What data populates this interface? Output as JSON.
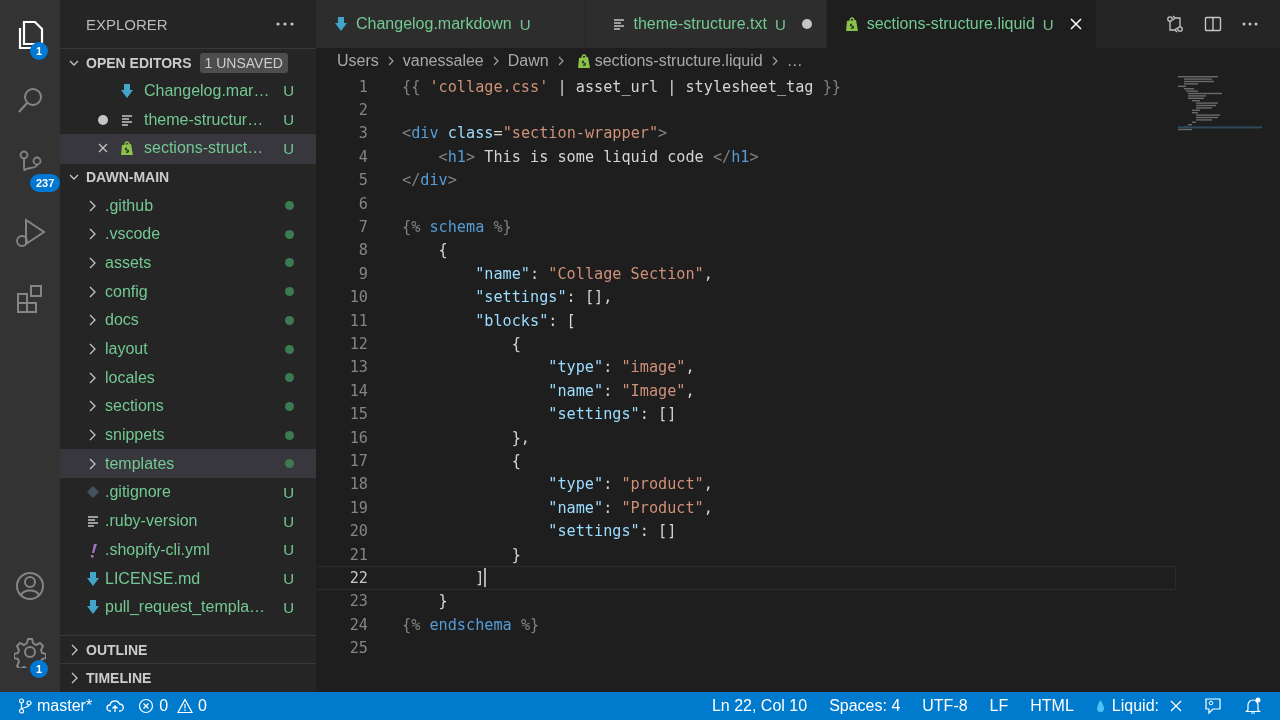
{
  "activity_bar": {
    "items": [
      {
        "kind": "files",
        "selected": true,
        "badge": "1"
      },
      {
        "kind": "search",
        "selected": false
      },
      {
        "kind": "source-control",
        "selected": false,
        "badge": "237"
      },
      {
        "kind": "run",
        "selected": false
      },
      {
        "kind": "extensions",
        "selected": false
      }
    ],
    "bottom": [
      {
        "kind": "account"
      },
      {
        "kind": "settings",
        "badge": "1"
      }
    ]
  },
  "sidebar": {
    "title": "EXPLORER",
    "open_editors": {
      "title": "OPEN EDITORS",
      "expanded": true,
      "badge": "1 UNSAVED",
      "items": [
        {
          "name": "Changelog.mar…",
          "kind": "markdown",
          "status": "U",
          "dirty": false,
          "selected": false
        },
        {
          "name": "theme-structur…",
          "kind": "text",
          "status": "U",
          "dirty": true,
          "selected": false
        },
        {
          "name": "sections-struct…",
          "kind": "shopify",
          "status": "U",
          "dirty": false,
          "selected": true
        }
      ]
    },
    "folder": {
      "title": "DAWN-MAIN",
      "expanded": true,
      "items": [
        {
          "kind": "folder",
          "name": ".github",
          "expanded": false,
          "selected": false
        },
        {
          "kind": "folder",
          "name": ".vscode",
          "expanded": false,
          "selected": false
        },
        {
          "kind": "folder",
          "name": "assets",
          "expanded": false,
          "selected": false
        },
        {
          "kind": "folder",
          "name": "config",
          "expanded": false,
          "selected": false
        },
        {
          "kind": "folder",
          "name": "docs",
          "expanded": false,
          "selected": false
        },
        {
          "kind": "folder",
          "name": "layout",
          "expanded": false,
          "selected": false
        },
        {
          "kind": "folder",
          "name": "locales",
          "expanded": false,
          "selected": false
        },
        {
          "kind": "folder",
          "name": "sections",
          "expanded": false,
          "selected": false
        },
        {
          "kind": "folder",
          "name": "snippets",
          "expanded": false,
          "selected": false
        },
        {
          "kind": "folder",
          "name": "templates",
          "expanded": false,
          "selected": true
        },
        {
          "kind": "git",
          "name": ".gitignore",
          "status": "U",
          "selected": false
        },
        {
          "kind": "text",
          "name": ".ruby-version",
          "status": "U",
          "selected": false
        },
        {
          "kind": "yaml",
          "name": ".shopify-cli.yml",
          "status": "U",
          "selected": false
        },
        {
          "kind": "markdown",
          "name": "LICENSE.md",
          "status": "U",
          "selected": false
        },
        {
          "kind": "markdown",
          "name": "pull_request_templa…",
          "status": "U",
          "selected": false
        }
      ]
    },
    "panels": [
      {
        "title": "OUTLINE",
        "expanded": false
      },
      {
        "title": "TIMELINE",
        "expanded": false
      }
    ]
  },
  "editor": {
    "tabs": [
      {
        "label": "Changelog.markdown",
        "kind": "markdown",
        "status": "U",
        "dirty": false,
        "selected": false
      },
      {
        "label": "theme-structure.txt",
        "kind": "text",
        "status": "U",
        "dirty": true,
        "selected": false
      },
      {
        "label": "sections-structure.liquid",
        "kind": "shopify",
        "status": "U",
        "dirty": false,
        "selected": true
      }
    ],
    "breadcrumbs": [
      {
        "label": "Users",
        "kind": "folder"
      },
      {
        "label": "vanessalee",
        "kind": "folder"
      },
      {
        "label": "Dawn",
        "kind": "folder"
      },
      {
        "label": "sections-structure.liquid",
        "kind": "shopify"
      },
      {
        "label": "…",
        "kind": "more"
      }
    ],
    "lines": [
      {
        "number": "1",
        "current": false,
        "tokens": [
          {
            "t": "{{ ",
            "kind": "delim"
          },
          {
            "t": "'collage.css'",
            "kind": "string"
          },
          {
            "t": " | asset_url | stylesheet_tag ",
            "kind": "text"
          },
          {
            "t": "}}",
            "kind": "delim"
          }
        ]
      },
      {
        "number": "2",
        "current": false
      },
      {
        "number": "3",
        "current": false,
        "tokens": [
          {
            "t": "<",
            "kind": "delim"
          },
          {
            "t": "div",
            "kind": "tag"
          },
          {
            "t": " class",
            "kind": "attr"
          },
          {
            "t": "=",
            "kind": "text"
          },
          {
            "t": "\"section-wrapper\"",
            "kind": "string"
          },
          {
            "t": ">",
            "kind": "delim"
          }
        ]
      },
      {
        "number": "4",
        "current": false,
        "tokens": [
          {
            "t": "    <",
            "kind": "delim"
          },
          {
            "t": "h1",
            "kind": "tag"
          },
          {
            "t": ">",
            "kind": "delim"
          },
          {
            "t": " This is some liquid code ",
            "kind": "text"
          },
          {
            "t": "</",
            "kind": "delim"
          },
          {
            "t": "h1",
            "kind": "tag"
          },
          {
            "t": ">",
            "kind": "delim"
          }
        ]
      },
      {
        "number": "5",
        "current": false,
        "tokens": [
          {
            "t": "</",
            "kind": "delim"
          },
          {
            "t": "div",
            "kind": "tag"
          },
          {
            "t": ">",
            "kind": "delim"
          }
        ]
      },
      {
        "number": "6",
        "current": false
      },
      {
        "number": "7",
        "current": false,
        "tokens": [
          {
            "t": "{% ",
            "kind": "delim"
          },
          {
            "t": "schema",
            "kind": "tag"
          },
          {
            "t": " %}",
            "kind": "delim"
          }
        ]
      },
      {
        "number": "8",
        "current": false,
        "tokens": [
          {
            "t": "    {",
            "kind": "text"
          }
        ]
      },
      {
        "number": "9",
        "current": false,
        "tokens": [
          {
            "t": "        \"name\"",
            "kind": "attr"
          },
          {
            "t": ": ",
            "kind": "text"
          },
          {
            "t": "\"Collage Section\"",
            "kind": "string"
          },
          {
            "t": ",",
            "kind": "text"
          }
        ]
      },
      {
        "number": "10",
        "current": false,
        "tokens": [
          {
            "t": "        \"settings\"",
            "kind": "attr"
          },
          {
            "t": ": [],",
            "kind": "text"
          }
        ]
      },
      {
        "number": "11",
        "current": false,
        "tokens": [
          {
            "t": "        \"blocks\"",
            "kind": "attr"
          },
          {
            "t": ": [",
            "kind": "text"
          }
        ]
      },
      {
        "number": "12",
        "current": false,
        "tokens": [
          {
            "t": "            {",
            "kind": "text"
          }
        ]
      },
      {
        "number": "13",
        "current": false,
        "tokens": [
          {
            "t": "                \"type\"",
            "kind": "attr"
          },
          {
            "t": ": ",
            "kind": "text"
          },
          {
            "t": "\"image\"",
            "kind": "string"
          },
          {
            "t": ",",
            "kind": "text"
          }
        ]
      },
      {
        "number": "14",
        "current": false,
        "tokens": [
          {
            "t": "                \"name\"",
            "kind": "attr"
          },
          {
            "t": ": ",
            "kind": "text"
          },
          {
            "t": "\"Image\"",
            "kind": "string"
          },
          {
            "t": ",",
            "kind": "text"
          }
        ]
      },
      {
        "number": "15",
        "current": false,
        "tokens": [
          {
            "t": "                \"settings\"",
            "kind": "attr"
          },
          {
            "t": ": []",
            "kind": "text"
          }
        ]
      },
      {
        "number": "16",
        "current": false,
        "tokens": [
          {
            "t": "            },",
            "kind": "text"
          }
        ]
      },
      {
        "number": "17",
        "current": false,
        "tokens": [
          {
            "t": "            {",
            "kind": "text"
          }
        ]
      },
      {
        "number": "18",
        "current": false,
        "tokens": [
          {
            "t": "                \"type\"",
            "kind": "attr"
          },
          {
            "t": ": ",
            "kind": "text"
          },
          {
            "t": "\"product\"",
            "kind": "string"
          },
          {
            "t": ",",
            "kind": "text"
          }
        ]
      },
      {
        "number": "19",
        "current": false,
        "tokens": [
          {
            "t": "                \"name\"",
            "kind": "attr"
          },
          {
            "t": ": ",
            "kind": "text"
          },
          {
            "t": "\"Product\"",
            "kind": "string"
          },
          {
            "t": ",",
            "kind": "text"
          }
        ]
      },
      {
        "number": "20",
        "current": false,
        "tokens": [
          {
            "t": "                \"settings\"",
            "kind": "attr"
          },
          {
            "t": ": []",
            "kind": "text"
          }
        ]
      },
      {
        "number": "21",
        "current": false,
        "tokens": [
          {
            "t": "            }",
            "kind": "text"
          }
        ]
      },
      {
        "number": "22",
        "current": true,
        "tokens": [
          {
            "t": "        ]",
            "kind": "text"
          }
        ]
      },
      {
        "number": "23",
        "current": false,
        "tokens": [
          {
            "t": "    }",
            "kind": "text"
          }
        ]
      },
      {
        "number": "24",
        "current": false,
        "tokens": [
          {
            "t": "{% ",
            "kind": "delim"
          },
          {
            "t": "endschema",
            "kind": "tag"
          },
          {
            "t": " %}",
            "kind": "delim"
          }
        ]
      },
      {
        "number": "25",
        "current": false
      }
    ]
  },
  "status_bar": {
    "left": [
      {
        "kind": "branch",
        "label": "master*"
      },
      {
        "kind": "sync"
      },
      {
        "kind": "problems",
        "errors": "0",
        "warnings": "0"
      }
    ],
    "right": [
      {
        "kind": "text",
        "label": "Ln 22, Col 10"
      },
      {
        "kind": "text",
        "label": "Spaces: 4"
      },
      {
        "kind": "text",
        "label": "UTF-8"
      },
      {
        "kind": "text",
        "label": "LF"
      },
      {
        "kind": "text",
        "label": "HTML"
      },
      {
        "kind": "language",
        "label": "Liquid:"
      },
      {
        "kind": "feedback"
      },
      {
        "kind": "notifications"
      }
    ]
  }
}
